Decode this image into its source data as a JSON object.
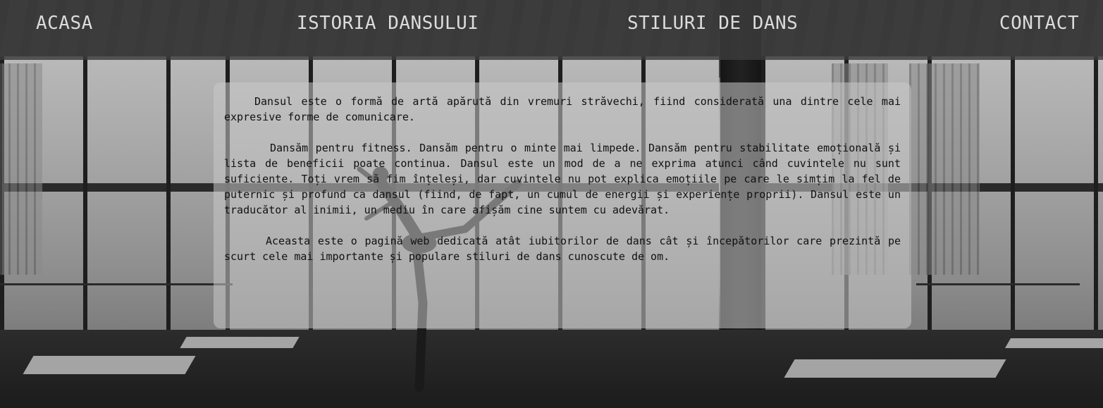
{
  "nav": {
    "items": [
      {
        "label": "ACASA"
      },
      {
        "label": "ISTORIA DANSULUI"
      },
      {
        "label": "STILURI DE DANS"
      },
      {
        "label": "CONTACT"
      }
    ]
  },
  "intro": {
    "paragraphs": [
      "Dansul este o formă de artă apărută din vremuri străvechi, fiind considerată una dintre cele mai expresive forme de comunicare.",
      "Dansăm pentru fitness. Dansăm pentru o minte mai limpede. Dansăm pentru stabilitate emoțională și lista de beneficii poate continua. Dansul este un mod de a ne exprima atunci când cuvintele nu sunt suficiente. Toți vrem să fim înțeleși, dar cuvintele nu pot explica emoțiile pe care le simțim la fel de puternic și profund ca dansul (fiind, de fapt, un cumul de energii și experiențe proprii). Dansul este un traducător al inimii, un mediu în care afișăm cine suntem cu adevărat.",
      "Aceasta este o pagină web dedicată atât iubitorilor de dans cât și începătorilor care prezintă pe scurt cele mai importante și populare stiluri de dans cunoscute de om."
    ]
  },
  "theme": {
    "nav_bg": "#3c3c3c",
    "nav_text": "#dcdcdc",
    "panel_bg": "#c8c8c8",
    "text": "#111111"
  }
}
